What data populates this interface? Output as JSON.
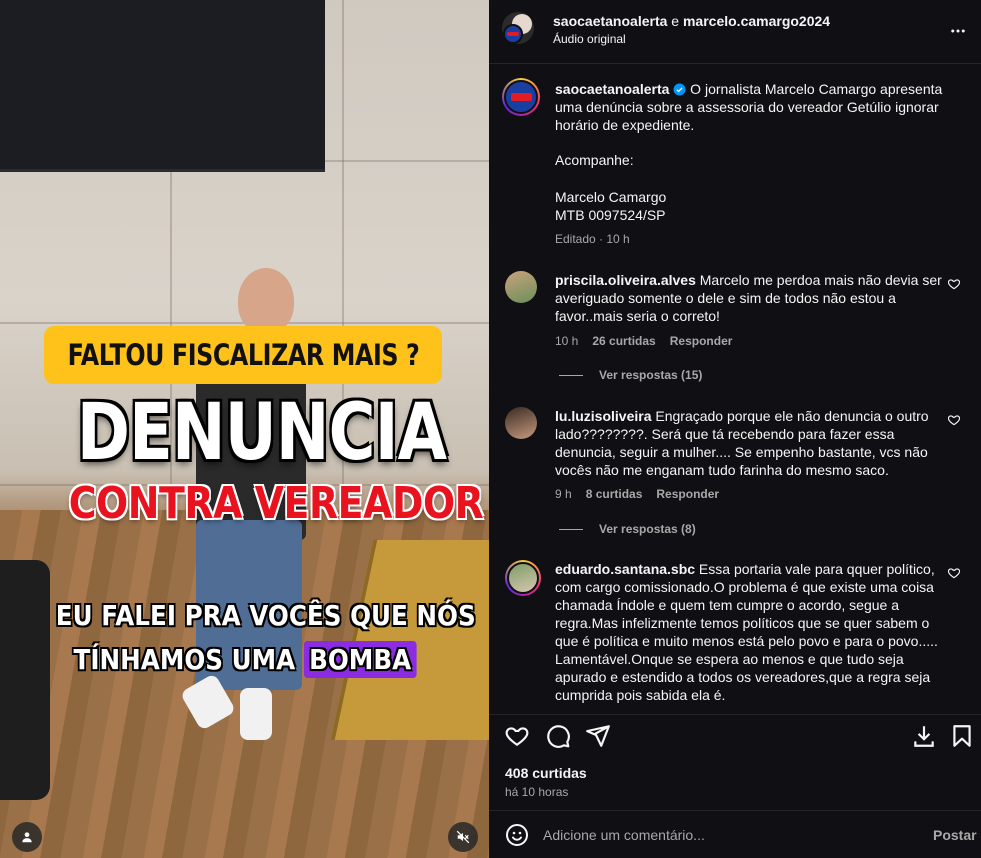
{
  "video": {
    "banner_top": "FALTOU FISCALIZAR MAIS ?",
    "headline": "DENUNCIA",
    "subheadline": "CONTRA VEREADOR",
    "caption_line1": "EU FALEI PRA VOCÊS QUE NÓS",
    "caption_line2_prefix": "TÍNHAMOS UMA ",
    "caption_line2_highlight": "BOMBA",
    "highlight_color": "#8b2be2",
    "banner_color": "#ffc21a",
    "subheadline_color": "#e9121f"
  },
  "header": {
    "user1": "saocaetanoalerta",
    "joiner": " e ",
    "user2": "marcelo.camargo2024",
    "audio": "Áudio original",
    "more_icon": "more-horizontal-icon"
  },
  "post": {
    "username": "saocaetanoalerta",
    "verified_icon": "verified-badge-icon",
    "caption_line1": " O jornalista Marcelo Camargo apresenta uma denúncia sobre a assessoria do vereador Getúlio ignorar horário de expediente.",
    "caption_line2": "Acompanhe:",
    "caption_line3": "Marcelo Camargo",
    "caption_line4": "MTB 0097524/SP",
    "edited": "Editado · 10 h"
  },
  "comments": [
    {
      "username": "priscila.oliveira.alves",
      "text": " Marcelo me perdoa mais não devia ser averiguado somente o dele e sim de todos não estou a favor..mais seria o correto!",
      "time": "10 h",
      "likes": "26 curtidas",
      "reply": "Responder",
      "view_replies": "Ver respostas (15)"
    },
    {
      "username": "lu.luzisoliveira",
      "text": " Engraçado porque ele não denuncia o outro lado????????. Será que tá recebendo para fazer essa denuncia, seguir a mulher.... Se empenho bastante, vcs não vocês não me enganam tudo farinha do mesmo saco.",
      "time": "9 h",
      "likes": "8 curtidas",
      "reply": "Responder",
      "view_replies": "Ver respostas (8)"
    },
    {
      "username": "eduardo.santana.sbc",
      "text": " Essa portaria vale para qquer político, com cargo comissionado.O problema é que existe uma coisa chamada Índole e quem tem cumpre o acordo, segue a regra.Mas infelizmente temos políticos que se quer sabem o que é política e muito menos está pelo povo e para o povo..... Lamentável.Onque se espera ao menos e que tudo seja apurado e estendido a todos os vereadores,que a regra seja cumprida pois sabida ela é."
    }
  ],
  "actions": {
    "likes": "408 curtidas",
    "time": "há 10 horas",
    "icons": [
      "heart-icon",
      "comment-icon",
      "share-icon",
      "download-icon",
      "bookmark-icon"
    ]
  },
  "add_comment": {
    "placeholder": "Adicione um comentário...",
    "post_label": "Postar",
    "emoji_icon": "emoji-icon"
  }
}
